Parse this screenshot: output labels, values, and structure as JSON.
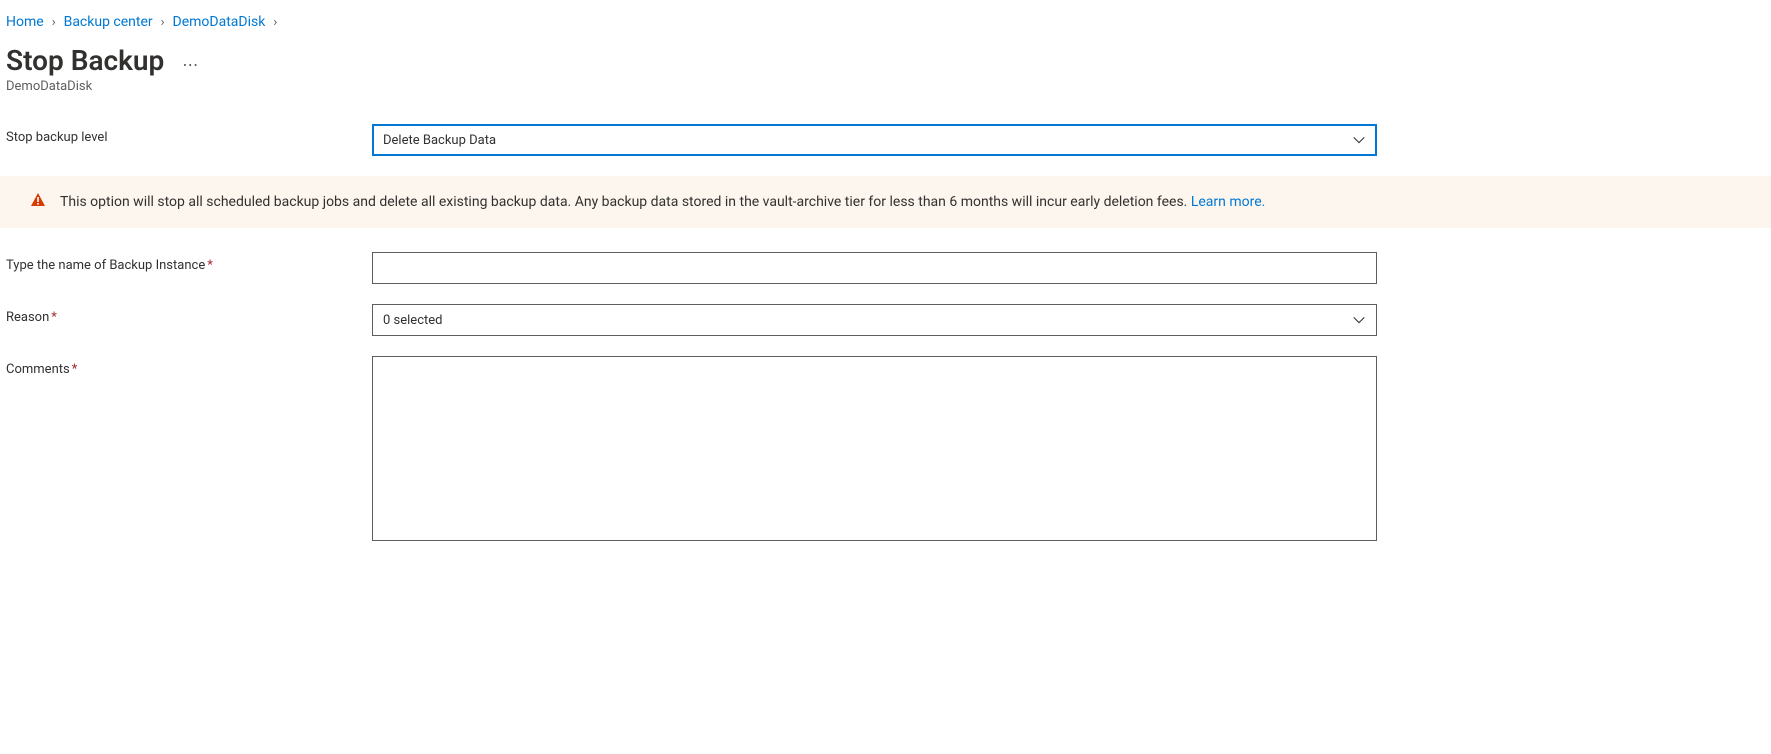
{
  "breadcrumb": {
    "items": [
      {
        "label": "Home"
      },
      {
        "label": "Backup center"
      },
      {
        "label": "DemoDataDisk"
      }
    ]
  },
  "header": {
    "title": "Stop Backup",
    "subtitle": "DemoDataDisk"
  },
  "form": {
    "stop_level": {
      "label": "Stop backup level",
      "value": "Delete Backup Data"
    },
    "instance_name": {
      "label": "Type the name of Backup Instance",
      "value": ""
    },
    "reason": {
      "label": "Reason",
      "value": "0 selected"
    },
    "comments": {
      "label": "Comments",
      "value": ""
    }
  },
  "warning": {
    "text": "This option will stop all scheduled backup jobs and delete all existing backup data. Any backup data stored in the vault-archive tier for less than 6 months will incur early deletion fees. ",
    "link_text": "Learn more."
  }
}
